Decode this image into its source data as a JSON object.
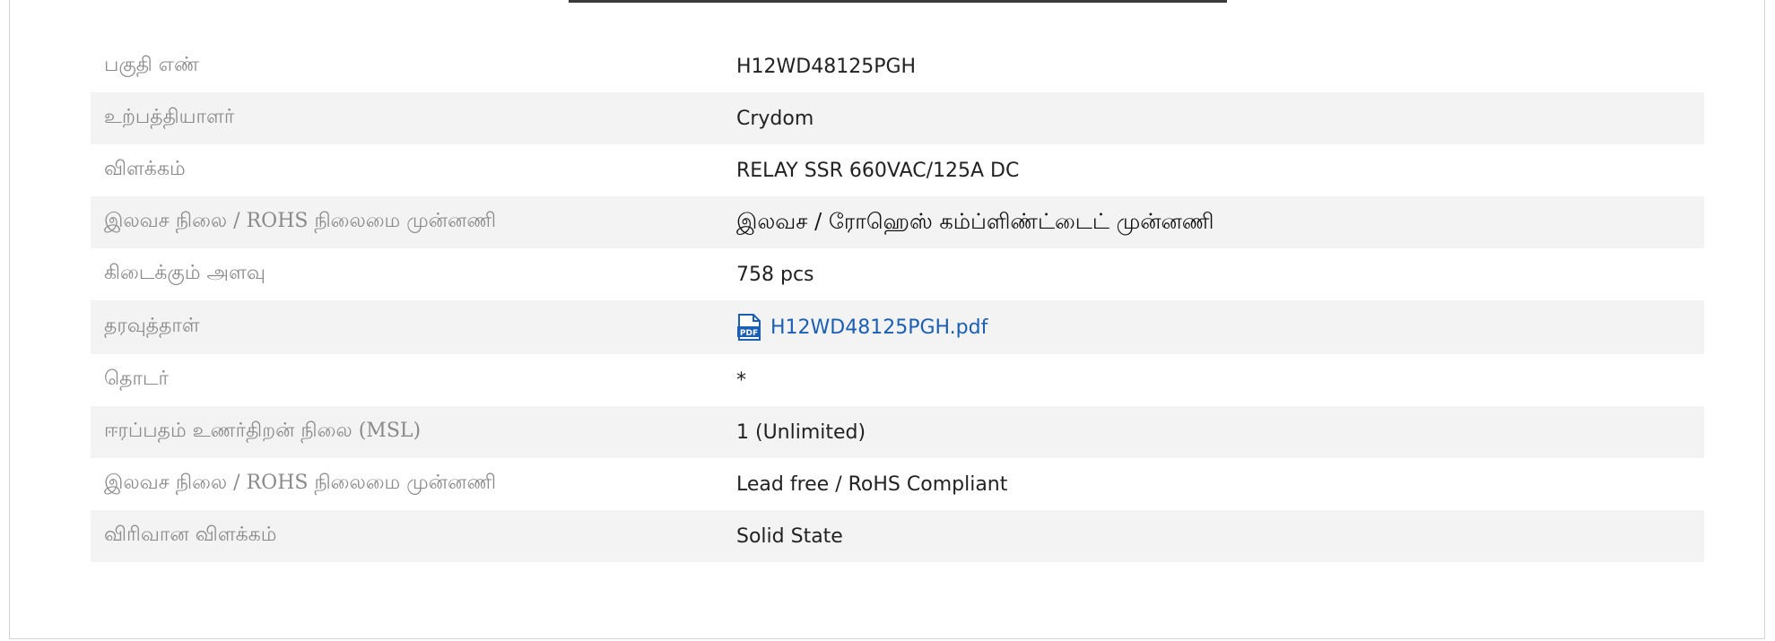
{
  "specs": {
    "rows": [
      {
        "label": "பகுதி எண்",
        "value": "H12WD48125PGH"
      },
      {
        "label": "உற்பத்தியாளர்",
        "value": "Crydom"
      },
      {
        "label": "விளக்கம்",
        "value": "RELAY SSR 660VAC/125A DC"
      },
      {
        "label": "இலவச நிலை / ROHS நிலைமை முன்னணி",
        "value": "இலவச / ரோஹெஸ் கம்ப்ளிண்ட்டைட் முன்னணி"
      },
      {
        "label": "கிடைக்கும் அளவு",
        "value": "758 pcs"
      },
      {
        "label": "தரவுத்தாள்",
        "value": "H12WD48125PGH.pdf",
        "icon": "pdf-file-icon"
      },
      {
        "label": "தொடர்",
        "value": "*"
      },
      {
        "label": "ஈரப்பதம் உணர்திறன் நிலை (MSL)",
        "value": "1 (Unlimited)"
      },
      {
        "label": "இலவச நிலை / ROHS நிலைமை முன்னணி",
        "value": "Lead free / RoHS Compliant"
      },
      {
        "label": "விரிவான விளக்கம்",
        "value": "Solid State"
      }
    ]
  },
  "colors": {
    "label_text": "#8a8a8a",
    "value_text": "#222222",
    "link": "#1a5fb4",
    "alt_row_bg": "#f3f3f3",
    "top_rule": "#3a3a3a",
    "panel_border": "#d4d4d4"
  }
}
